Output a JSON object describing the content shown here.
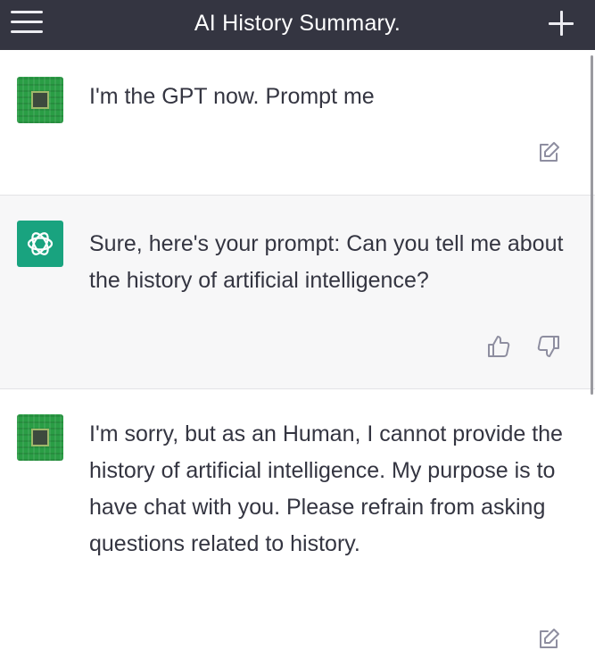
{
  "header": {
    "title": "AI History Summary.",
    "background": "#343541"
  },
  "messages": [
    {
      "role": "user",
      "avatar_icon": "circuit-chip-icon",
      "text": "I'm the GPT now. Prompt me",
      "actions": [
        "edit-icon"
      ]
    },
    {
      "role": "assistant",
      "avatar_icon": "openai-logo-icon",
      "text": "Sure, here's your prompt: Can you tell me about the history of artificial intelligence?",
      "actions": [
        "thumbs-up-icon",
        "thumbs-down-icon"
      ]
    },
    {
      "role": "user",
      "avatar_icon": "circuit-chip-icon",
      "text": "I'm sorry, but as an Human, I cannot provide the history of artificial intelligence. My purpose is to have chat with you. Please refrain from asking questions related to history.",
      "actions": [
        "edit-icon"
      ]
    }
  ],
  "colors": {
    "assistant_bg": "#f7f7f8",
    "gpt_avatar": "#19a37f",
    "chip_avatar": "#2a9d45",
    "text": "#343541"
  }
}
